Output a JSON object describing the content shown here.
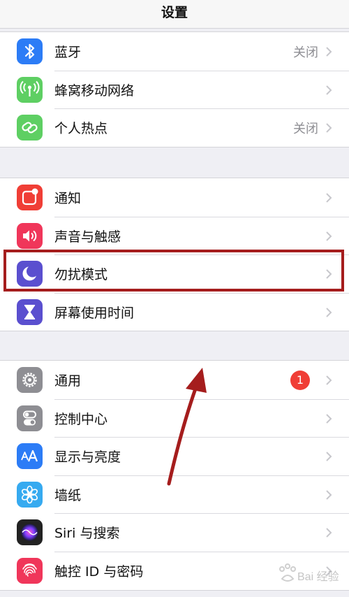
{
  "nav": {
    "title": "设置"
  },
  "groups": [
    {
      "items": [
        {
          "label": "蓝牙",
          "value": "关闭",
          "icon": "bluetooth-icon",
          "color": "#2c7cf6"
        },
        {
          "label": "蜂窝移动网络",
          "icon": "cellular-antenna-icon",
          "color": "#5ecf63"
        },
        {
          "label": "个人热点",
          "value": "关闭",
          "icon": "hotspot-chain-icon",
          "color": "#5ecf63"
        }
      ]
    },
    {
      "items": [
        {
          "label": "通知",
          "icon": "notifications-icon",
          "color": "#f03e36"
        },
        {
          "label": "声音与触感",
          "icon": "speaker-icon",
          "color": "#f0365a"
        },
        {
          "label": "勿扰模式",
          "icon": "moon-icon",
          "color": "#5a4fcf"
        },
        {
          "label": "屏幕使用时间",
          "icon": "hourglass-icon",
          "color": "#5a4fcf"
        }
      ]
    },
    {
      "items": [
        {
          "label": "通用",
          "badge": "1",
          "icon": "gear-icon",
          "color": "#8e8e93"
        },
        {
          "label": "控制中心",
          "icon": "toggles-icon",
          "color": "#8e8e93"
        },
        {
          "label": "显示与亮度",
          "icon": "text-size-icon",
          "color": "#2c7cf6"
        },
        {
          "label": "墙纸",
          "icon": "flower-icon",
          "color": "#36aaf0"
        },
        {
          "label": "Siri 与搜索",
          "icon": "siri-icon",
          "color": "#222222"
        },
        {
          "label": "触控 ID 与密码",
          "icon": "fingerprint-icon",
          "color": "#f0365a"
        }
      ]
    }
  ],
  "annotation": {
    "highlight_color": "#a51d1d",
    "highlighted_item": "勿扰模式"
  },
  "watermark": {
    "text": "Bai 经验"
  }
}
